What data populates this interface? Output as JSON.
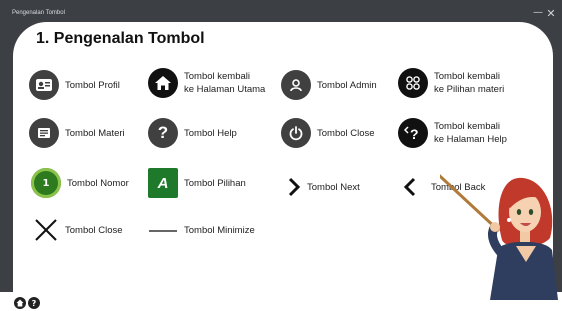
{
  "window": {
    "title": "Pengenalan Tombol"
  },
  "page": {
    "title": "1. Pengenalan Tombol"
  },
  "items": [
    {
      "label": "Tombol Profil",
      "icon": "profile-card-icon"
    },
    {
      "label": "Tombol kembali\nke Halaman Utama",
      "icon": "home-icon"
    },
    {
      "label": "Tombol Admin",
      "icon": "admin-icon"
    },
    {
      "label": "Tombol kembali\nke Pilihan materi",
      "icon": "grid-icon"
    },
    {
      "label": "Tombol Materi",
      "icon": "book-icon"
    },
    {
      "label": "Tombol Help",
      "icon": "question-icon"
    },
    {
      "label": "Tombol Close",
      "icon": "power-icon"
    },
    {
      "label": "Tombol kembali\nke Halaman Help",
      "icon": "help-back-icon"
    },
    {
      "label": "Tombol Nomor",
      "icon": "number-icon",
      "icon_text": "1"
    },
    {
      "label": "Tombol Pilihan",
      "icon": "choice-icon",
      "icon_text": "A"
    },
    {
      "label": "Tombol Next",
      "icon": "chevron-right-icon"
    },
    {
      "label": "Tombol Back",
      "icon": "chevron-left-icon"
    },
    {
      "label": "Tombol Close",
      "icon": "close-x-icon"
    },
    {
      "label": "Tombol Minimize",
      "icon": "minimize-line-icon"
    }
  ],
  "colors": {
    "frame": "#3c3f44",
    "icon_dark": "#404040",
    "green": "#2d7a1f"
  }
}
